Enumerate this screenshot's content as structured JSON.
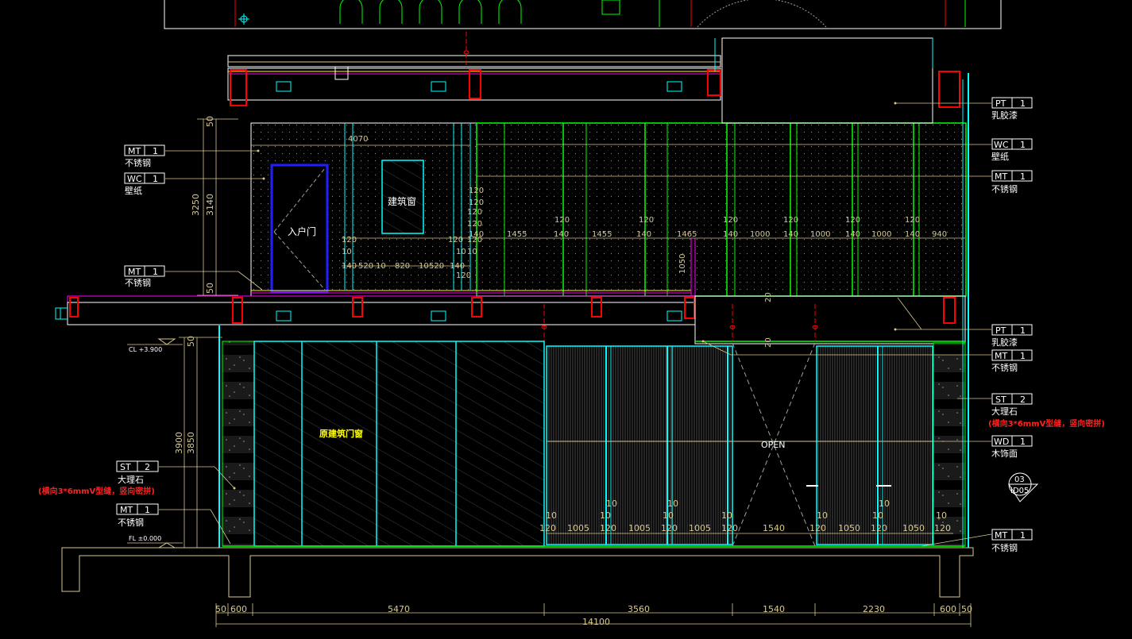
{
  "colors": {
    "background": "#000000",
    "cyan": "#00ffff",
    "green": "#00ff00",
    "red": "#ff0000",
    "magenta": "#ff00ff",
    "yellow": "#ffff00",
    "blue": "#2020ff",
    "white": "#ffffff",
    "tan": "#d8c890",
    "dim_gray": "#a0a0a0"
  },
  "labels": {
    "entry_door": "入户门",
    "building_window": "建筑窗",
    "original_door_window": "原建筑门窗",
    "open": "OPEN",
    "cl_level": "CL +3.900",
    "fl_level": "FL ±0.000",
    "section_mark_top": "03",
    "section_mark_bottom": "ID05"
  },
  "tags_left": [
    {
      "code": "MT",
      "num": "1",
      "desc": "不锈钢"
    },
    {
      "code": "WC",
      "num": "1",
      "desc": "壁纸"
    },
    {
      "code": "MT",
      "num": "1",
      "desc": "不锈钢"
    },
    {
      "code": "ST",
      "num": "2",
      "desc": "大理石",
      "note": "(横向3*6mmV型缝，竖向密拼)"
    },
    {
      "code": "MT",
      "num": "1",
      "desc": "不锈钢"
    }
  ],
  "tags_right": [
    {
      "code": "PT",
      "num": "1",
      "desc": "乳胶漆"
    },
    {
      "code": "WC",
      "num": "1",
      "desc": "壁纸"
    },
    {
      "code": "MT",
      "num": "1",
      "desc": "不锈钢"
    },
    {
      "code": "PT",
      "num": "1",
      "desc": "乳胶漆"
    },
    {
      "code": "MT",
      "num": "1",
      "desc": "不锈钢"
    },
    {
      "code": "ST",
      "num": "2",
      "desc": "大理石",
      "note": "(横向3*6mmV型缝，竖向密拼)"
    },
    {
      "code": "WD",
      "num": "1",
      "desc": "木饰面"
    },
    {
      "code": "MT",
      "num": "1",
      "desc": "不锈钢"
    }
  ],
  "dims_bottom": [
    "50",
    "600",
    "5470",
    "3560",
    "1540",
    "2230",
    "600",
    "50"
  ],
  "dim_total": "14100",
  "dims_vertical_upper": [
    "3250",
    "3140",
    "50",
    "50"
  ],
  "dims_vertical_lower": [
    "3900",
    "3850",
    "50"
  ],
  "dims_upper_row": [
    "140",
    "1455",
    "140",
    "1455",
    "140",
    "1465",
    "140",
    "1000",
    "140",
    "1000",
    "140",
    "1000",
    "140",
    "940"
  ],
  "dims_upper_small": [
    "120",
    "120",
    "120",
    "120",
    "120",
    "120",
    "120",
    "120"
  ],
  "dims_upper_left": [
    "140",
    "520",
    "10",
    "820",
    "10",
    "520",
    "140"
  ],
  "dims_upper_misc": [
    "4070",
    "1050",
    "120",
    "10",
    "20",
    "20",
    "10",
    "10",
    "120",
    "120",
    "120",
    "120",
    "120"
  ],
  "dims_lower_row": [
    "120",
    "1005",
    "120",
    "1005",
    "120",
    "1005",
    "120",
    "1540",
    "120",
    "1050",
    "120",
    "1050",
    "120"
  ],
  "dims_lower_small": [
    "10",
    "10",
    "10",
    "10",
    "10",
    "10",
    "10",
    "10",
    "10",
    "10"
  ]
}
